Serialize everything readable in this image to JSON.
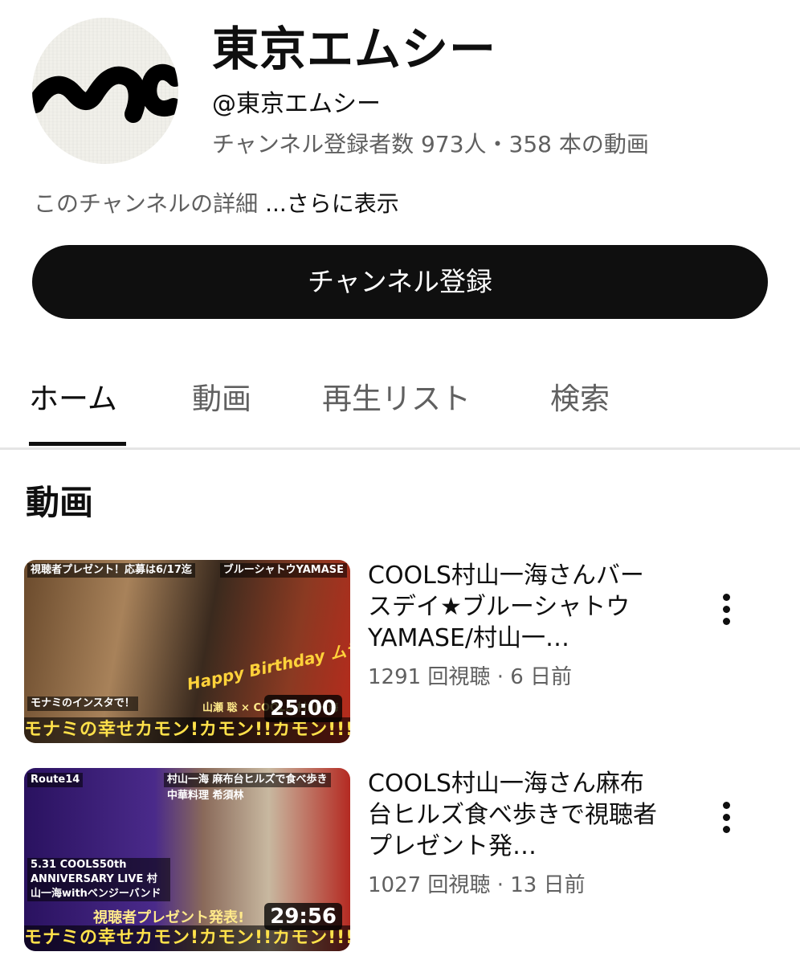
{
  "channel": {
    "name": "東京エムシー",
    "handle": "@東京エムシー",
    "stats": "チャンネル登録者数 973人・358 本の動画",
    "description_prefix": "このチャンネルの詳細 ",
    "description_more": "...さらに表示",
    "subscribe_label": "チャンネル登録",
    "avatar_icon": "mc-logo"
  },
  "tabs": [
    {
      "label": "ホーム",
      "active": true
    },
    {
      "label": "動画",
      "active": false
    },
    {
      "label": "再生リスト",
      "active": false
    },
    {
      "label": "検索",
      "active": false
    }
  ],
  "section": {
    "title": "動画"
  },
  "videos": [
    {
      "title": "COOLS村山一海さんバースデイ★ブルーシャトウYAMASE/村山一…",
      "meta": "1291 回視聴 · 6 日前",
      "duration": "25:00",
      "thumb_texts": {
        "top_left": "視聴者プレゼント！応募は6/17迄",
        "top_right": "ブルーシャトウYAMASE",
        "overlay": "Happy Birthday ムラさん",
        "left_caption": "モナミのインスタで！",
        "right_caption": "山瀬 聡 × COOLS 村山一海",
        "banner": "モナミの幸せカモン!カモン!!カモン!!!"
      }
    },
    {
      "title": "COOLS村山一海さん麻布台ヒルズ食べ歩きで視聴者プレゼント発…",
      "meta": "1027 回視聴 · 13 日前",
      "duration": "29:56",
      "thumb_texts": {
        "top_left": "Route14",
        "top_right": "村山一海 麻布台ヒルズで食べ歩き",
        "top_right_sub": "中華料理 希須林",
        "left_caption": "5.31 COOLS50th ANNIVERSARY LIVE 村山一海withベンジーバンド",
        "center_caption": "視聴者プレゼント発表!",
        "banner": "モナミの幸せカモン!カモン!!カモン!!!"
      }
    }
  ]
}
